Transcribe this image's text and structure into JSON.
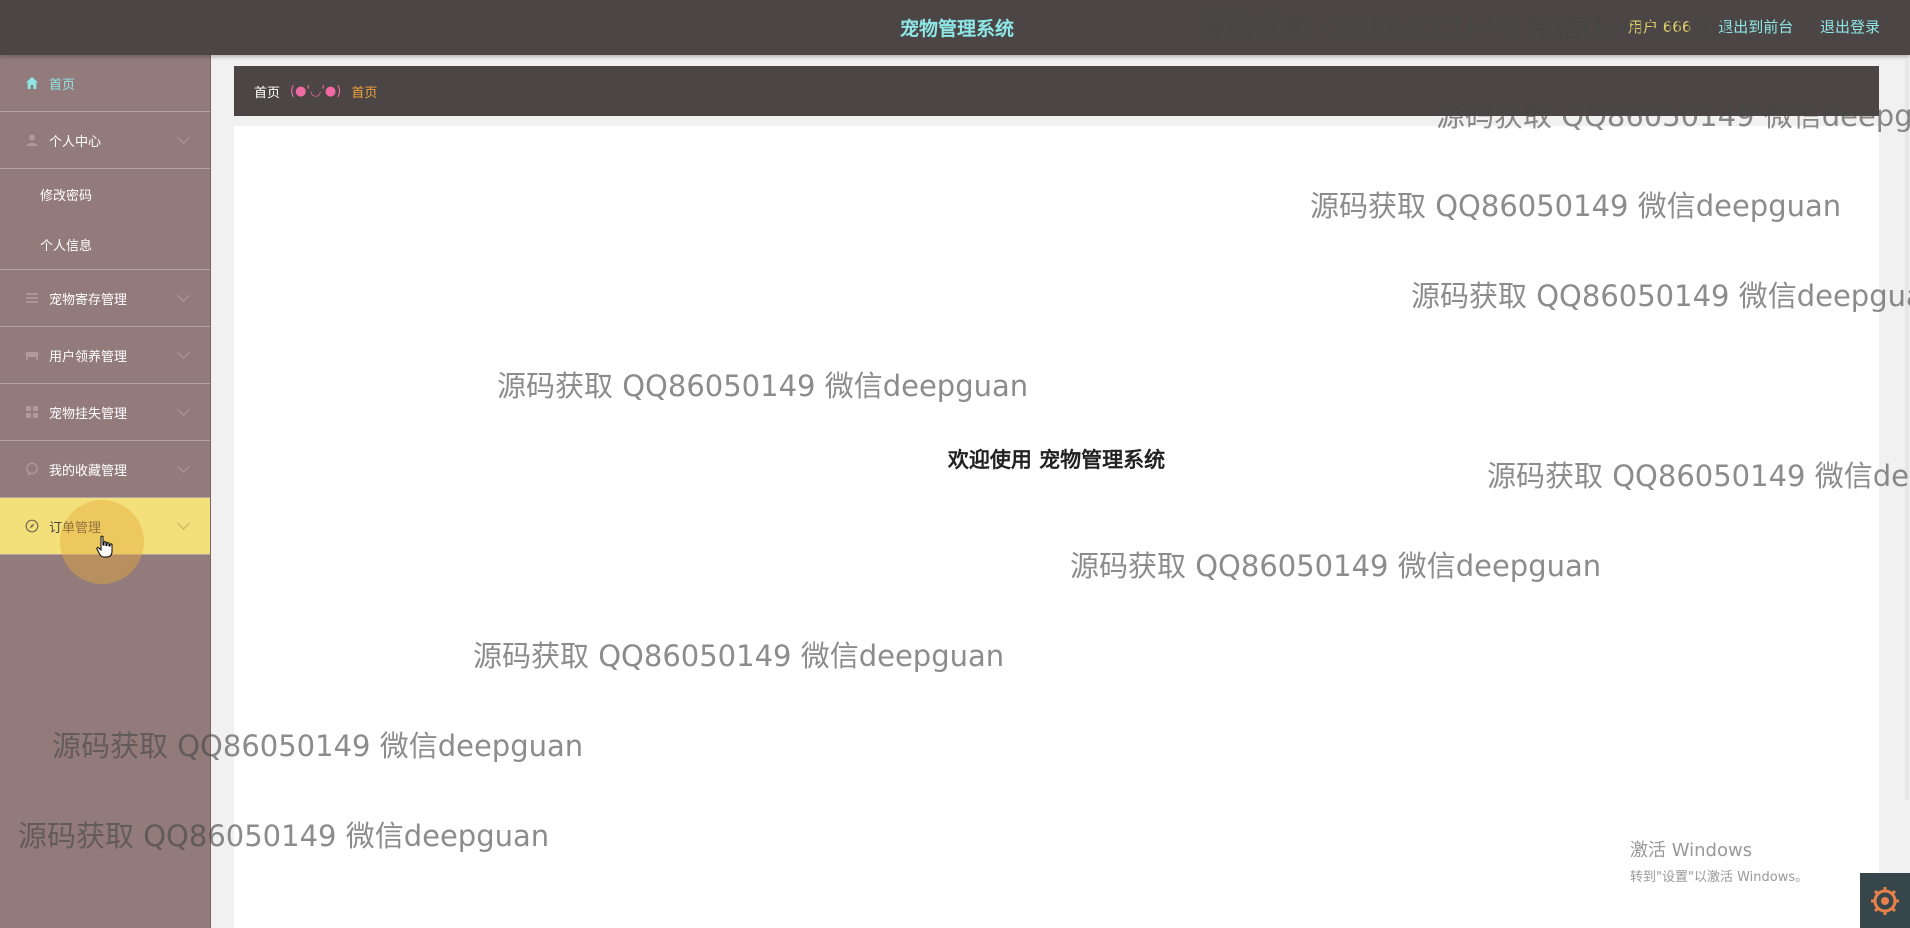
{
  "header": {
    "title": "宠物管理系统",
    "user_label": "用户 666",
    "front_link": "退出到前台",
    "logout_link": "退出登录"
  },
  "sidebar": {
    "items": [
      {
        "label": "首页",
        "icon": "home-icon"
      },
      {
        "label": "个人中心",
        "icon": "user-icon",
        "children": [
          "修改密码",
          "个人信息"
        ]
      },
      {
        "label": "宠物寄存管理",
        "icon": "list-icon"
      },
      {
        "label": "用户领养管理",
        "icon": "bed-icon"
      },
      {
        "label": "宠物挂失管理",
        "icon": "grid-icon"
      },
      {
        "label": "我的收藏管理",
        "icon": "chat-icon"
      },
      {
        "label": "订单管理",
        "icon": "compass-icon"
      }
    ]
  },
  "breadcrumb": {
    "home": "首页",
    "separator": "(●'◡'●)",
    "current": "首页"
  },
  "main": {
    "welcome": "欢迎使用 宠物管理系统"
  },
  "watermark_text": "源码获取 QQ86050149 微信deepguan",
  "windows_activation": {
    "line1": "激活 Windows",
    "line2": "转到\"设置\"以激活 Windows。"
  },
  "colors": {
    "header_bg": "#4b4545",
    "sidebar_bg": "#937b7c",
    "accent_cyan": "#8ee6e6",
    "active_item": "#f3e07a",
    "breadcrumb_current": "#f2a33a"
  }
}
